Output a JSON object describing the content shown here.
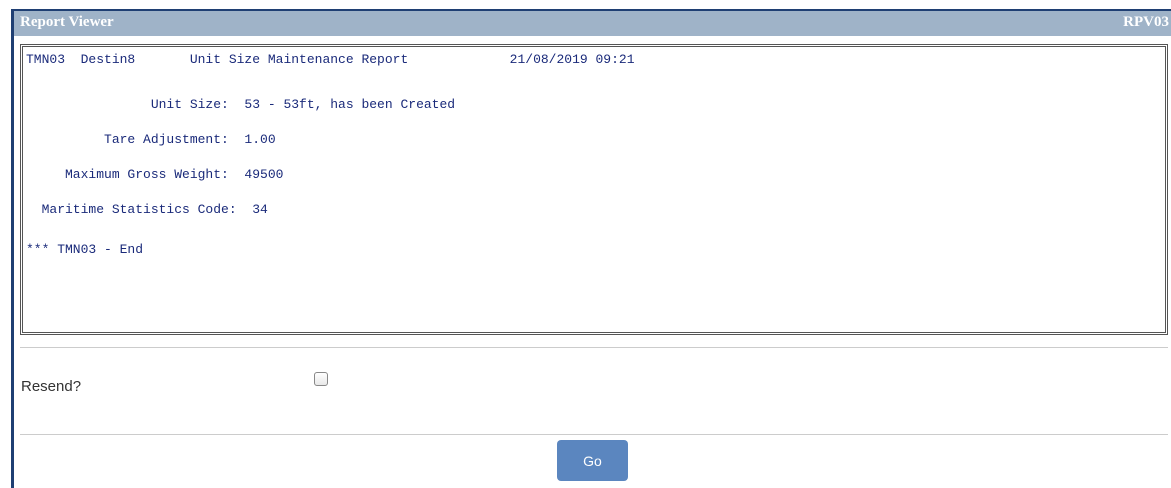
{
  "window": {
    "title": "Report Viewer",
    "code": "RPV03"
  },
  "report": {
    "lines": [
      "TMN03  Destin8       Unit Size Maintenance Report             21/08/2019 09:21",
      "                Unit Size:  53 - 53ft, has been Created",
      "          Tare Adjustment:  1.00",
      "     Maximum Gross Weight:  49500",
      "  Maritime Statistics Code:  34",
      "*** TMN03 - End"
    ]
  },
  "form": {
    "resend_label": "Resend?",
    "resend_checked": false,
    "go_label": "Go"
  }
}
